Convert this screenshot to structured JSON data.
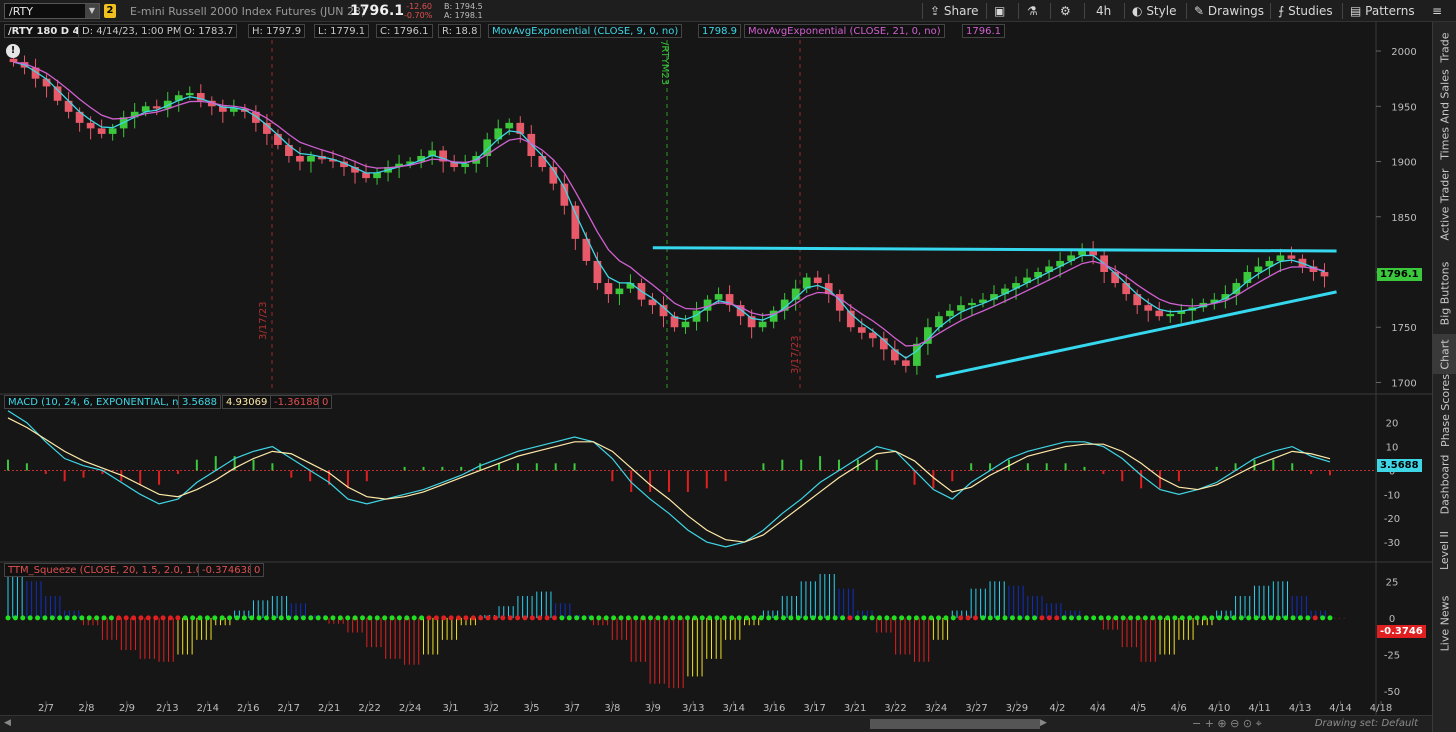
{
  "toolbar": {
    "symbol": "/RTY",
    "link_badge": "2",
    "description": "E-mini Russell 2000 Index Futures (JUN 23)",
    "last_price": "1796.1",
    "change": "-12.60",
    "change_pct": "-0.70%",
    "bid": "B: 1794.5",
    "ask": "A: 1798.1",
    "share_label": "Share",
    "timeframe_label": "4h",
    "style_label": "Style",
    "drawings_label": "Drawings",
    "studies_label": "Studies",
    "patterns_label": "Patterns"
  },
  "chart_header": {
    "title": "/RTY 180 D 4h",
    "date": "D: 4/14/23, 1:00 PM",
    "open": "O: 1783.7",
    "high": "H: 1797.9",
    "low": "L: 1779.1",
    "close": "C: 1796.1",
    "range": "R: 18.8",
    "ema9_label": "MovAvgExponential (CLOSE, 9, 0, no)",
    "ema9_value": "1798.9",
    "ema21_label": "MovAvgExponential (CLOSE, 21, 0, no)",
    "ema21_value": "1796.1",
    "event_marker_1": "/RTYM23",
    "event_marker_2": "3/17/23",
    "event_marker_3": "3/17/23"
  },
  "macd_header": {
    "label": "MACD (10, 24, 6, EXPONENTIAL, no)",
    "value": "3.5688",
    "avg": "4.93069",
    "diff": "-1.36188",
    "zero": "0"
  },
  "ttm_header": {
    "label": "TTM_Squeeze (CLOSE, 20, 1.5, 2.0, 1.0)",
    "value": "-0.374638",
    "zero": "0"
  },
  "price_tags": {
    "price": "1796.1",
    "macd": "3.5688",
    "ttm": "-0.3746"
  },
  "side_tabs": [
    "Trade",
    "Times And Sales",
    "Active Trader",
    "Big Buttons",
    "Chart",
    "Phase Scores",
    "Dashboard",
    "Level II",
    "Live News"
  ],
  "active_side_tab": "Chart",
  "drawing_set": "Drawing set: Default",
  "colors": {
    "up": "#3cc83c",
    "down": "#e85a6a",
    "ema9": "#3fd6e6",
    "ema21": "#d060d0",
    "trendline": "#35d8ee",
    "macd_line": "#3fd6e6",
    "macd_avg": "#ffe9a8",
    "squeeze_on": "#e02020",
    "squeeze_off": "#20e020"
  },
  "chart_data": [
    {
      "type": "line",
      "title": "/RTY 180 D 4h",
      "y_ticks": [
        2000,
        1950,
        1900,
        1850,
        1800,
        1750,
        1700
      ],
      "ylim": [
        1695,
        2010
      ],
      "x_ticks": [
        "2/7",
        "2/8",
        "2/9",
        "2/13",
        "2/14",
        "2/16",
        "2/17",
        "2/21",
        "2/22",
        "2/24",
        "3/1",
        "3/2",
        "3/5",
        "3/7",
        "3/8",
        "3/9",
        "3/13",
        "3/14",
        "3/16",
        "3/17",
        "3/21",
        "3/22",
        "3/24",
        "3/27",
        "3/29",
        "4/2",
        "4/4",
        "4/5",
        "4/6",
        "4/10",
        "4/11",
        "4/13",
        "4/14",
        "4/18"
      ],
      "series": [
        {
          "name": "/RTY",
          "values": [
            1990,
            1985,
            1975,
            1968,
            1955,
            1945,
            1935,
            1930,
            1925,
            1930,
            1940,
            1945,
            1950,
            1948,
            1955,
            1960,
            1962,
            1955,
            1950,
            1945,
            1948,
            1945,
            1935,
            1925,
            1915,
            1905,
            1900,
            1905,
            1902,
            1900,
            1895,
            1890,
            1885,
            1890,
            1895,
            1898,
            1900,
            1905,
            1910,
            1900,
            1895,
            1898,
            1905,
            1920,
            1930,
            1935,
            1925,
            1905,
            1895,
            1880,
            1860,
            1830,
            1810,
            1790,
            1780,
            1785,
            1790,
            1775,
            1770,
            1760,
            1750,
            1755,
            1765,
            1775,
            1780,
            1770,
            1760,
            1750,
            1755,
            1765,
            1775,
            1785,
            1795,
            1790,
            1780,
            1765,
            1750,
            1745,
            1740,
            1730,
            1720,
            1715,
            1735,
            1750,
            1760,
            1765,
            1770,
            1772,
            1775,
            1780,
            1785,
            1790,
            1795,
            1800,
            1805,
            1810,
            1815,
            1820,
            1815,
            1800,
            1790,
            1780,
            1770,
            1765,
            1760,
            1762,
            1765,
            1768,
            1772,
            1775,
            1780,
            1790,
            1800,
            1805,
            1810,
            1815,
            1812,
            1805,
            1800,
            1796
          ]
        }
      ],
      "trendlines": [
        {
          "name": "resistance",
          "from": [
            "3/9",
            1822
          ],
          "to": [
            "4/14",
            1819
          ]
        },
        {
          "name": "support",
          "from": [
            "3/24",
            1705
          ],
          "to": [
            "4/14",
            1782
          ]
        }
      ]
    },
    {
      "type": "line",
      "title": "MACD (10, 24, 6, EXPONENTIAL, no)",
      "y_ticks": [
        20,
        10,
        0,
        -10,
        -20,
        -30
      ],
      "ylim": [
        -35,
        27
      ],
      "series": [
        {
          "name": "Value",
          "values": [
            25,
            20,
            12,
            5,
            2,
            0,
            -5,
            -10,
            -14,
            -12,
            -5,
            0,
            5,
            8,
            10,
            5,
            0,
            -5,
            -12,
            -14,
            -12,
            -10,
            -8,
            -5,
            -2,
            2,
            5,
            8,
            10,
            12,
            14,
            12,
            5,
            -5,
            -12,
            -18,
            -25,
            -30,
            -32,
            -30,
            -25,
            -18,
            -12,
            -5,
            0,
            5,
            10,
            8,
            0,
            -8,
            -12,
            -5,
            0,
            5,
            8,
            10,
            12,
            12,
            10,
            5,
            -2,
            -8,
            -10,
            -8,
            -5,
            0,
            5,
            8,
            10,
            6,
            3.5688
          ]
        },
        {
          "name": "Avg",
          "values": [
            22,
            18,
            13,
            8,
            4,
            1,
            -2,
            -6,
            -10,
            -11,
            -8,
            -4,
            1,
            5,
            8,
            7,
            3,
            -1,
            -7,
            -11,
            -12,
            -11,
            -9,
            -6,
            -3,
            0,
            3,
            6,
            8,
            10,
            12,
            12,
            8,
            1,
            -6,
            -12,
            -19,
            -25,
            -29,
            -30,
            -27,
            -21,
            -15,
            -9,
            -3,
            2,
            7,
            8,
            4,
            -3,
            -9,
            -7,
            -2,
            2,
            6,
            8,
            10,
            11,
            11,
            8,
            3,
            -3,
            -7,
            -8,
            -6,
            -2,
            2,
            5,
            8,
            7,
            4.93069
          ]
        }
      ]
    },
    {
      "type": "bar",
      "title": "TTM_Squeeze (CLOSE, 20, 1.5, 2.0, 1.0)",
      "y_ticks": [
        25,
        0,
        -25,
        -50
      ],
      "ylim": [
        -52,
        30
      ],
      "series": [
        {
          "name": "Histogram",
          "values": [
            30,
            25,
            15,
            5,
            -5,
            -15,
            -22,
            -28,
            -30,
            -25,
            -15,
            -5,
            5,
            12,
            15,
            10,
            2,
            -4,
            -10,
            -20,
            -28,
            -32,
            -25,
            -15,
            -5,
            2,
            8,
            15,
            18,
            10,
            2,
            -5,
            -15,
            -30,
            -45,
            -48,
            -40,
            -28,
            -15,
            -5,
            5,
            15,
            25,
            30,
            20,
            5,
            -10,
            -25,
            -30,
            -15,
            5,
            20,
            25,
            22,
            15,
            10,
            5,
            0,
            -8,
            -20,
            -30,
            -25,
            -15,
            -5,
            5,
            15,
            22,
            25,
            15,
            5,
            -0.3746
          ]
        }
      ]
    }
  ]
}
